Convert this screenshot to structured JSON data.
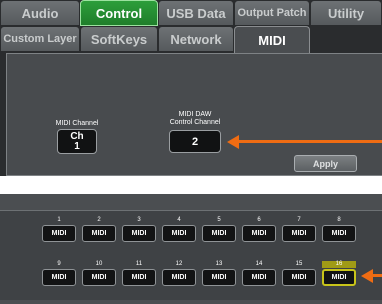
{
  "tabs_row1": [
    {
      "label": "Audio",
      "state": "normal"
    },
    {
      "label": "Control",
      "state": "selected-green"
    },
    {
      "label": "USB Data",
      "state": "normal"
    },
    {
      "label": "Output Patch",
      "state": "normal"
    },
    {
      "label": "Utility",
      "state": "normal"
    }
  ],
  "tabs_row2": [
    {
      "label": "Custom Layer",
      "state": "normal"
    },
    {
      "label": "SoftKeys",
      "state": "normal"
    },
    {
      "label": "Network",
      "state": "normal"
    },
    {
      "label": "MIDI",
      "state": "active"
    }
  ],
  "midi_panel": {
    "channel_label": "MIDI Channel",
    "channel_btn_top": "Ch",
    "channel_btn_value": "1",
    "daw_label_line1": "MIDI DAW",
    "daw_label_line2": "Control Channel",
    "daw_value": "2",
    "apply_label": "Apply"
  },
  "softkey_grid": {
    "row1": [
      {
        "num": "1",
        "label": "MIDI"
      },
      {
        "num": "2",
        "label": "MIDI"
      },
      {
        "num": "3",
        "label": "MIDI"
      },
      {
        "num": "4",
        "label": "MIDI"
      },
      {
        "num": "5",
        "label": "MIDI"
      },
      {
        "num": "6",
        "label": "MIDI"
      },
      {
        "num": "7",
        "label": "MIDI"
      },
      {
        "num": "8",
        "label": "MIDI"
      }
    ],
    "row2": [
      {
        "num": "9",
        "label": "MIDI"
      },
      {
        "num": "10",
        "label": "MIDI"
      },
      {
        "num": "11",
        "label": "MIDI"
      },
      {
        "num": "12",
        "label": "MIDI"
      },
      {
        "num": "13",
        "label": "MIDI"
      },
      {
        "num": "14",
        "label": "MIDI"
      },
      {
        "num": "15",
        "label": "MIDI"
      },
      {
        "num": "16",
        "label": "MIDI"
      }
    ],
    "selected": "16"
  },
  "colors": {
    "accent_green": "#2c9e3a",
    "highlight_yellow": "#c8c41a",
    "arrow_orange": "#ef6c13"
  }
}
